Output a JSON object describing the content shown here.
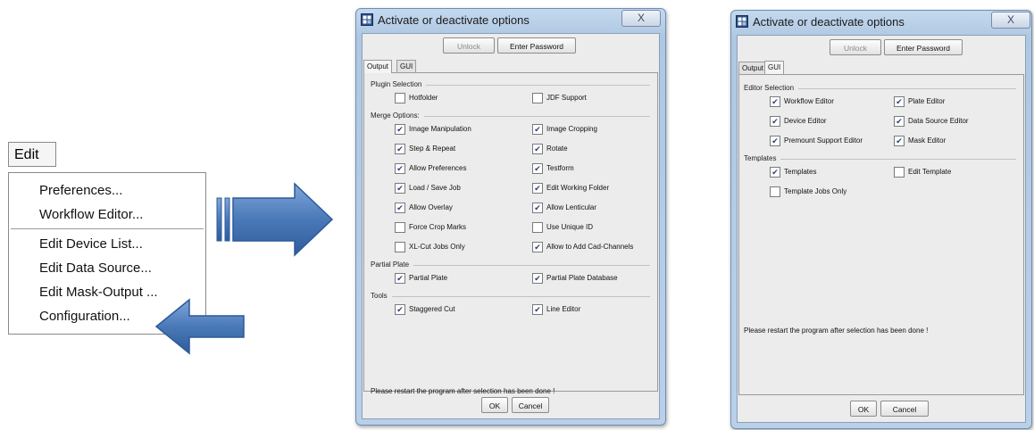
{
  "edit_menu": {
    "title": "Edit",
    "items": [
      "Preferences...",
      "Workflow Editor...",
      "Edit Device List...",
      "Edit Data Source...",
      "Edit Mask-Output ...",
      "Configuration..."
    ]
  },
  "dialog_output": {
    "title": "Activate or deactivate options",
    "close": "X",
    "unlock": "Unlock",
    "enter_password": "Enter Password",
    "tabs": [
      "Output",
      "GUI"
    ],
    "active_tab": "Output",
    "groups": [
      {
        "label": "Plugin Selection",
        "items": [
          {
            "label": "Hotfolder",
            "checked": false
          },
          {
            "label": "JDF Support",
            "checked": false
          }
        ]
      },
      {
        "label": "Merge Options:",
        "items": [
          {
            "label": "Image Manipulation",
            "checked": true
          },
          {
            "label": "Image Cropping",
            "checked": true
          },
          {
            "label": "Step & Repeat",
            "checked": true
          },
          {
            "label": "Rotate",
            "checked": true
          },
          {
            "label": "Allow Preferences",
            "checked": true
          },
          {
            "label": "Testform",
            "checked": true
          },
          {
            "label": "Load / Save Job",
            "checked": true
          },
          {
            "label": "Edit Working Folder",
            "checked": true
          },
          {
            "label": "Allow Overlay",
            "checked": true
          },
          {
            "label": "Allow Lenticular",
            "checked": true
          },
          {
            "label": "Force Crop Marks",
            "checked": false
          },
          {
            "label": "Use Unique ID",
            "checked": false
          },
          {
            "label": "XL-Cut Jobs Only",
            "checked": false
          },
          {
            "label": "Allow to Add Cad-Channels",
            "checked": true
          }
        ]
      },
      {
        "label": "Partial Plate",
        "items": [
          {
            "label": "Partial Plate",
            "checked": true
          },
          {
            "label": "Partial Plate Database",
            "checked": true
          }
        ]
      },
      {
        "label": "Tools",
        "items": [
          {
            "label": "Staggered Cut",
            "checked": true
          },
          {
            "label": "Line Editor",
            "checked": true
          }
        ]
      }
    ],
    "note": "Please restart the program after selection has been done !",
    "ok": "OK",
    "cancel": "Cancel"
  },
  "dialog_gui": {
    "title": "Activate or deactivate options",
    "close": "X",
    "unlock": "Unlock",
    "enter_password": "Enter Password",
    "tabs": [
      "Output",
      "GUI"
    ],
    "active_tab": "GUI",
    "groups": [
      {
        "label": "Editor Selection",
        "items": [
          {
            "label": "Workflow Editor",
            "checked": true
          },
          {
            "label": "Plate Editor",
            "checked": true
          },
          {
            "label": "Device Editor",
            "checked": true
          },
          {
            "label": "Data Source Editor",
            "checked": true
          },
          {
            "label": "Premount Support Editor",
            "checked": true
          },
          {
            "label": "Mask Editor",
            "checked": true
          }
        ]
      },
      {
        "label": "Templates",
        "items": [
          {
            "label": "Templates",
            "checked": true
          },
          {
            "label": "Edit Template",
            "checked": false
          },
          {
            "label": "Template Jobs Only",
            "checked": false
          }
        ]
      }
    ],
    "note": "Please restart the program after selection has been done !",
    "ok": "OK",
    "cancel": "Cancel"
  },
  "colors": {
    "arrow": "#4a79b8",
    "arrow_dark": "#2d5a98",
    "check": "#2a3f7a"
  },
  "icons": [
    "window-app-icon",
    "close-icon",
    "checkmark-icon",
    "arrow-right-icon",
    "arrow-left-icon"
  ]
}
